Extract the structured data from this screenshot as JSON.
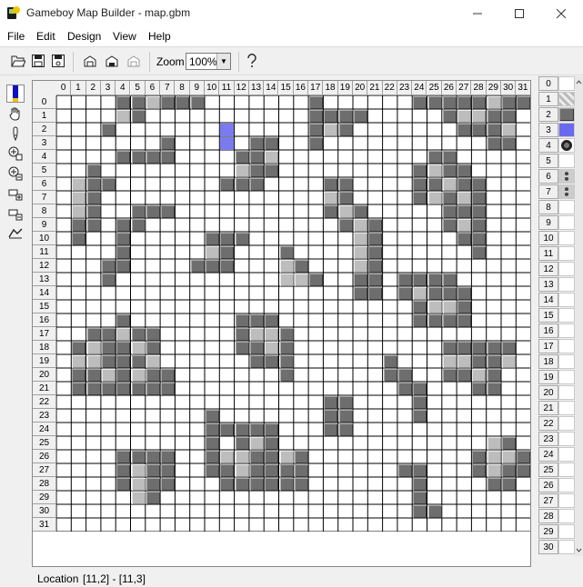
{
  "window": {
    "title": "Gameboy Map Builder - map.gbm",
    "controls": [
      "minimize-icon",
      "maximize-icon",
      "close-icon"
    ]
  },
  "menu": [
    "File",
    "Edit",
    "Design",
    "View",
    "Help"
  ],
  "toolbar": {
    "buttons": [
      "open-icon",
      "save-icon",
      "save-as-icon",
      "paste-tile-icon",
      "copy-tile-icon",
      "cut-tile-icon"
    ],
    "zoom_label": "Zoom",
    "zoom_value": "100%",
    "help_icon": "help-icon"
  },
  "tools": [
    "pen-tool-icon",
    "hand-tool-icon",
    "dropper-tool-icon",
    "insert-column-icon",
    "delete-column-icon",
    "insert-row-icon",
    "delete-row-icon",
    "props-tool-icon"
  ],
  "map": {
    "columns": [
      "0",
      "1",
      "2",
      "3",
      "4",
      "5",
      "6",
      "7",
      "8",
      "9",
      "10",
      "11",
      "12",
      "13",
      "14",
      "15",
      "16",
      "17",
      "18",
      "19",
      "20",
      "21",
      "22",
      "23",
      "24",
      "25",
      "26",
      "27",
      "28",
      "29",
      "30",
      "31"
    ],
    "rows": [
      "0",
      "1",
      "2",
      "3",
      "4",
      "5",
      "6",
      "7",
      "8",
      "9",
      "10",
      "11",
      "12",
      "13",
      "14",
      "15",
      "16",
      "17",
      "18",
      "19",
      "20",
      "21",
      "22",
      "23",
      "24",
      "25",
      "26",
      "27",
      "28",
      "29",
      "30",
      "31"
    ],
    "tiles": [
      [
        4,
        0,
        "D"
      ],
      [
        5,
        0,
        "D"
      ],
      [
        6,
        0,
        "L"
      ],
      [
        7,
        0,
        "D"
      ],
      [
        8,
        0,
        "D"
      ],
      [
        9,
        0,
        "D"
      ],
      [
        17,
        0,
        "D"
      ],
      [
        24,
        0,
        "D"
      ],
      [
        25,
        0,
        "D"
      ],
      [
        26,
        0,
        "D"
      ],
      [
        27,
        0,
        "D"
      ],
      [
        28,
        0,
        "D"
      ],
      [
        29,
        0,
        "L"
      ],
      [
        30,
        0,
        "D"
      ],
      [
        31,
        0,
        "D"
      ],
      [
        4,
        1,
        "L"
      ],
      [
        5,
        1,
        "D"
      ],
      [
        17,
        1,
        "D"
      ],
      [
        18,
        1,
        "D"
      ],
      [
        19,
        1,
        "D"
      ],
      [
        20,
        1,
        "D"
      ],
      [
        26,
        1,
        "D"
      ],
      [
        27,
        1,
        "L"
      ],
      [
        28,
        1,
        "L"
      ],
      [
        29,
        1,
        "D"
      ],
      [
        30,
        1,
        "D"
      ],
      [
        3,
        2,
        "D"
      ],
      [
        11,
        2,
        "B"
      ],
      [
        17,
        2,
        "D"
      ],
      [
        18,
        2,
        "L"
      ],
      [
        19,
        2,
        "D"
      ],
      [
        27,
        2,
        "D"
      ],
      [
        28,
        2,
        "D"
      ],
      [
        29,
        2,
        "D"
      ],
      [
        30,
        2,
        "L"
      ],
      [
        7,
        3,
        "D"
      ],
      [
        11,
        3,
        "B"
      ],
      [
        13,
        3,
        "D"
      ],
      [
        14,
        3,
        "D"
      ],
      [
        17,
        3,
        "D"
      ],
      [
        29,
        3,
        "D"
      ],
      [
        30,
        3,
        "D"
      ],
      [
        4,
        4,
        "D"
      ],
      [
        5,
        4,
        "D"
      ],
      [
        6,
        4,
        "D"
      ],
      [
        7,
        4,
        "D"
      ],
      [
        12,
        4,
        "D"
      ],
      [
        13,
        4,
        "D"
      ],
      [
        14,
        4,
        "L"
      ],
      [
        25,
        4,
        "D"
      ],
      [
        26,
        4,
        "D"
      ],
      [
        2,
        5,
        "D"
      ],
      [
        12,
        5,
        "L"
      ],
      [
        13,
        5,
        "D"
      ],
      [
        14,
        5,
        "D"
      ],
      [
        24,
        5,
        "D"
      ],
      [
        25,
        5,
        "L"
      ],
      [
        26,
        5,
        "D"
      ],
      [
        27,
        5,
        "D"
      ],
      [
        1,
        6,
        "L"
      ],
      [
        2,
        6,
        "D"
      ],
      [
        3,
        6,
        "D"
      ],
      [
        11,
        6,
        "D"
      ],
      [
        12,
        6,
        "D"
      ],
      [
        13,
        6,
        "D"
      ],
      [
        18,
        6,
        "D"
      ],
      [
        19,
        6,
        "D"
      ],
      [
        24,
        6,
        "D"
      ],
      [
        25,
        6,
        "D"
      ],
      [
        26,
        6,
        "L"
      ],
      [
        27,
        6,
        "D"
      ],
      [
        28,
        6,
        "D"
      ],
      [
        1,
        7,
        "L"
      ],
      [
        2,
        7,
        "D"
      ],
      [
        18,
        7,
        "L"
      ],
      [
        19,
        7,
        "D"
      ],
      [
        24,
        7,
        "D"
      ],
      [
        25,
        7,
        "L"
      ],
      [
        26,
        7,
        "D"
      ],
      [
        27,
        7,
        "L"
      ],
      [
        28,
        7,
        "D"
      ],
      [
        1,
        8,
        "L"
      ],
      [
        2,
        8,
        "D"
      ],
      [
        5,
        8,
        "D"
      ],
      [
        6,
        8,
        "D"
      ],
      [
        7,
        8,
        "D"
      ],
      [
        18,
        8,
        "D"
      ],
      [
        19,
        8,
        "L"
      ],
      [
        20,
        8,
        "D"
      ],
      [
        26,
        8,
        "D"
      ],
      [
        27,
        8,
        "D"
      ],
      [
        28,
        8,
        "D"
      ],
      [
        1,
        9,
        "D"
      ],
      [
        2,
        9,
        "D"
      ],
      [
        4,
        9,
        "D"
      ],
      [
        5,
        9,
        "D"
      ],
      [
        19,
        9,
        "D"
      ],
      [
        20,
        9,
        "L"
      ],
      [
        21,
        9,
        "D"
      ],
      [
        26,
        9,
        "D"
      ],
      [
        27,
        9,
        "L"
      ],
      [
        28,
        9,
        "D"
      ],
      [
        1,
        10,
        "D"
      ],
      [
        4,
        10,
        "D"
      ],
      [
        10,
        10,
        "D"
      ],
      [
        11,
        10,
        "D"
      ],
      [
        12,
        10,
        "D"
      ],
      [
        20,
        10,
        "L"
      ],
      [
        21,
        10,
        "D"
      ],
      [
        27,
        10,
        "D"
      ],
      [
        28,
        10,
        "D"
      ],
      [
        4,
        11,
        "D"
      ],
      [
        10,
        11,
        "L"
      ],
      [
        11,
        11,
        "D"
      ],
      [
        15,
        11,
        "D"
      ],
      [
        20,
        11,
        "L"
      ],
      [
        21,
        11,
        "D"
      ],
      [
        28,
        11,
        "D"
      ],
      [
        3,
        12,
        "D"
      ],
      [
        4,
        12,
        "D"
      ],
      [
        9,
        12,
        "D"
      ],
      [
        10,
        12,
        "D"
      ],
      [
        11,
        12,
        "D"
      ],
      [
        15,
        12,
        "L"
      ],
      [
        16,
        12,
        "D"
      ],
      [
        20,
        12,
        "L"
      ],
      [
        21,
        12,
        "D"
      ],
      [
        3,
        13,
        "D"
      ],
      [
        15,
        13,
        "L"
      ],
      [
        16,
        13,
        "L"
      ],
      [
        17,
        13,
        "D"
      ],
      [
        20,
        13,
        "D"
      ],
      [
        21,
        13,
        "D"
      ],
      [
        23,
        13,
        "D"
      ],
      [
        24,
        13,
        "D"
      ],
      [
        25,
        13,
        "D"
      ],
      [
        26,
        13,
        "D"
      ],
      [
        20,
        14,
        "D"
      ],
      [
        21,
        14,
        "D"
      ],
      [
        23,
        14,
        "D"
      ],
      [
        24,
        14,
        "L"
      ],
      [
        25,
        14,
        "D"
      ],
      [
        26,
        14,
        "D"
      ],
      [
        27,
        14,
        "D"
      ],
      [
        24,
        15,
        "D"
      ],
      [
        25,
        15,
        "L"
      ],
      [
        26,
        15,
        "L"
      ],
      [
        27,
        15,
        "D"
      ],
      [
        4,
        16,
        "D"
      ],
      [
        12,
        16,
        "D"
      ],
      [
        13,
        16,
        "D"
      ],
      [
        14,
        16,
        "D"
      ],
      [
        24,
        16,
        "D"
      ],
      [
        25,
        16,
        "D"
      ],
      [
        26,
        16,
        "D"
      ],
      [
        27,
        16,
        "D"
      ],
      [
        2,
        17,
        "D"
      ],
      [
        3,
        17,
        "D"
      ],
      [
        4,
        17,
        "L"
      ],
      [
        5,
        17,
        "D"
      ],
      [
        6,
        17,
        "D"
      ],
      [
        12,
        17,
        "D"
      ],
      [
        13,
        17,
        "L"
      ],
      [
        14,
        17,
        "L"
      ],
      [
        15,
        17,
        "D"
      ],
      [
        1,
        18,
        "D"
      ],
      [
        2,
        18,
        "L"
      ],
      [
        3,
        18,
        "D"
      ],
      [
        4,
        18,
        "D"
      ],
      [
        5,
        18,
        "L"
      ],
      [
        6,
        18,
        "D"
      ],
      [
        12,
        18,
        "D"
      ],
      [
        13,
        18,
        "D"
      ],
      [
        14,
        18,
        "L"
      ],
      [
        15,
        18,
        "D"
      ],
      [
        26,
        18,
        "D"
      ],
      [
        27,
        18,
        "D"
      ],
      [
        28,
        18,
        "D"
      ],
      [
        29,
        18,
        "D"
      ],
      [
        30,
        18,
        "D"
      ],
      [
        1,
        19,
        "L"
      ],
      [
        2,
        19,
        "L"
      ],
      [
        3,
        19,
        "D"
      ],
      [
        4,
        19,
        "D"
      ],
      [
        5,
        19,
        "D"
      ],
      [
        6,
        19,
        "L"
      ],
      [
        13,
        19,
        "D"
      ],
      [
        14,
        19,
        "D"
      ],
      [
        15,
        19,
        "D"
      ],
      [
        22,
        19,
        "D"
      ],
      [
        26,
        19,
        "L"
      ],
      [
        27,
        19,
        "L"
      ],
      [
        28,
        19,
        "D"
      ],
      [
        29,
        19,
        "D"
      ],
      [
        30,
        19,
        "L"
      ],
      [
        1,
        20,
        "D"
      ],
      [
        2,
        20,
        "D"
      ],
      [
        3,
        20,
        "L"
      ],
      [
        4,
        20,
        "D"
      ],
      [
        5,
        20,
        "L"
      ],
      [
        6,
        20,
        "D"
      ],
      [
        7,
        20,
        "D"
      ],
      [
        15,
        20,
        "D"
      ],
      [
        22,
        20,
        "D"
      ],
      [
        23,
        20,
        "D"
      ],
      [
        26,
        20,
        "D"
      ],
      [
        27,
        20,
        "D"
      ],
      [
        28,
        20,
        "L"
      ],
      [
        29,
        20,
        "D"
      ],
      [
        1,
        21,
        "D"
      ],
      [
        2,
        21,
        "D"
      ],
      [
        3,
        21,
        "D"
      ],
      [
        4,
        21,
        "D"
      ],
      [
        5,
        21,
        "D"
      ],
      [
        6,
        21,
        "D"
      ],
      [
        7,
        21,
        "D"
      ],
      [
        23,
        21,
        "D"
      ],
      [
        24,
        21,
        "D"
      ],
      [
        28,
        21,
        "D"
      ],
      [
        29,
        21,
        "D"
      ],
      [
        18,
        22,
        "D"
      ],
      [
        19,
        22,
        "D"
      ],
      [
        24,
        22,
        "D"
      ],
      [
        10,
        23,
        "D"
      ],
      [
        18,
        23,
        "D"
      ],
      [
        19,
        23,
        "D"
      ],
      [
        24,
        23,
        "D"
      ],
      [
        10,
        24,
        "D"
      ],
      [
        11,
        24,
        "D"
      ],
      [
        12,
        24,
        "D"
      ],
      [
        13,
        24,
        "D"
      ],
      [
        14,
        24,
        "D"
      ],
      [
        18,
        24,
        "D"
      ],
      [
        19,
        24,
        "D"
      ],
      [
        10,
        25,
        "D"
      ],
      [
        12,
        25,
        "D"
      ],
      [
        13,
        25,
        "L"
      ],
      [
        14,
        25,
        "D"
      ],
      [
        29,
        25,
        "L"
      ],
      [
        30,
        25,
        "D"
      ],
      [
        4,
        26,
        "D"
      ],
      [
        5,
        26,
        "D"
      ],
      [
        6,
        26,
        "D"
      ],
      [
        7,
        26,
        "D"
      ],
      [
        10,
        26,
        "D"
      ],
      [
        11,
        26,
        "L"
      ],
      [
        12,
        26,
        "L"
      ],
      [
        13,
        26,
        "D"
      ],
      [
        14,
        26,
        "D"
      ],
      [
        15,
        26,
        "L"
      ],
      [
        16,
        26,
        "D"
      ],
      [
        28,
        26,
        "D"
      ],
      [
        29,
        26,
        "L"
      ],
      [
        30,
        26,
        "L"
      ],
      [
        31,
        26,
        "D"
      ],
      [
        4,
        27,
        "D"
      ],
      [
        5,
        27,
        "L"
      ],
      [
        6,
        27,
        "D"
      ],
      [
        7,
        27,
        "D"
      ],
      [
        10,
        27,
        "D"
      ],
      [
        11,
        27,
        "D"
      ],
      [
        12,
        27,
        "L"
      ],
      [
        13,
        27,
        "D"
      ],
      [
        14,
        27,
        "D"
      ],
      [
        15,
        27,
        "D"
      ],
      [
        16,
        27,
        "D"
      ],
      [
        23,
        27,
        "D"
      ],
      [
        24,
        27,
        "D"
      ],
      [
        28,
        27,
        "D"
      ],
      [
        29,
        27,
        "L"
      ],
      [
        30,
        27,
        "D"
      ],
      [
        31,
        27,
        "D"
      ],
      [
        4,
        28,
        "D"
      ],
      [
        5,
        28,
        "L"
      ],
      [
        6,
        28,
        "D"
      ],
      [
        7,
        28,
        "D"
      ],
      [
        11,
        28,
        "D"
      ],
      [
        12,
        28,
        "D"
      ],
      [
        13,
        28,
        "D"
      ],
      [
        14,
        28,
        "D"
      ],
      [
        15,
        28,
        "D"
      ],
      [
        16,
        28,
        "D"
      ],
      [
        24,
        28,
        "D"
      ],
      [
        29,
        28,
        "D"
      ],
      [
        30,
        28,
        "D"
      ],
      [
        5,
        29,
        "L"
      ],
      [
        6,
        29,
        "D"
      ],
      [
        24,
        29,
        "D"
      ],
      [
        24,
        30,
        "D"
      ],
      [
        25,
        30,
        "D"
      ]
    ]
  },
  "palette": {
    "rows": [
      "0",
      "1",
      "2",
      "3",
      "4",
      "5",
      "6",
      "7",
      "8",
      "9",
      "10",
      "11",
      "12",
      "13",
      "14",
      "15",
      "16",
      "17",
      "18",
      "19",
      "20",
      "21",
      "22",
      "23",
      "24",
      "25",
      "26",
      "27",
      "28",
      "29",
      "30"
    ],
    "tiles": [
      "empty",
      "checker",
      "dark-square",
      "blue-square",
      "ring",
      "empty",
      "studs",
      "studs"
    ]
  },
  "status": {
    "label": "Location",
    "value": "[11,2] - [11,3]"
  },
  "colors": {
    "dark_tile": "#6e6e6e",
    "light_tile": "#bdbdbd",
    "selection": "#7b7bf0"
  }
}
